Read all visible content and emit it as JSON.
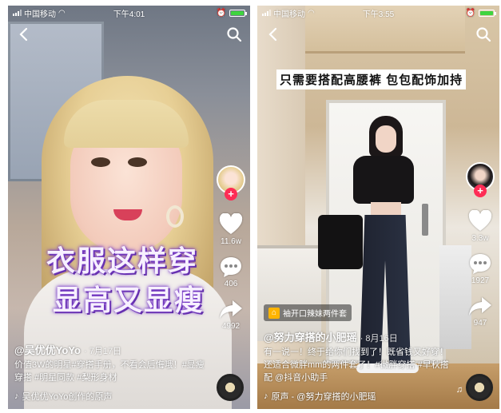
{
  "status_bars": [
    {
      "carrier": "中国移动",
      "time": "下午4:01"
    },
    {
      "carrier": "中国移动",
      "time": "下午3:55"
    }
  ],
  "videos": [
    {
      "overlay_lines": [
        "衣服这样穿",
        "显高又显瘦"
      ],
      "likes": "11.6w",
      "comments": "406",
      "shares": "4992",
      "author": "@吴优优YoYo",
      "date": "· 7月17日",
      "description": "价值3W的明星#穿搭手册，不看会后悔哦！#显瘦穿搭 #明星同款 #梨形身材",
      "music": "吴优优YoYo创作的原声",
      "follow_symbol": "+"
    },
    {
      "top_banner": "只需要搭配高腰裤 包包配饰加持",
      "shop_tag": "袖开口辣妹两件套",
      "likes": "3.3w",
      "comments": "1927",
      "shares": "947",
      "author": "@努力穿搭的小肥瑶",
      "date": "· 8月16日",
      "description": "有一说一！终于给你们找到了！既省钱又好穿！还适合微胖mm的两件套了！#微胖穿搭 #早秋搭配 @抖音小助手",
      "music": "原声 - @努力穿搭的小肥瑶",
      "follow_symbol": "+"
    }
  ],
  "colors": {
    "like_heart": "#ffffff",
    "follow_badge": "#fe2c55",
    "battery_fill": "#3fd43f",
    "caption_glow": "#7a3dc8",
    "shop_icon": "#ffb400"
  },
  "icons": [
    "back-icon",
    "search-icon",
    "heart-icon",
    "comment-icon",
    "share-icon",
    "music-disc-icon",
    "music-note-icon",
    "cart-icon",
    "alarm-icon",
    "wifi-icon"
  ]
}
